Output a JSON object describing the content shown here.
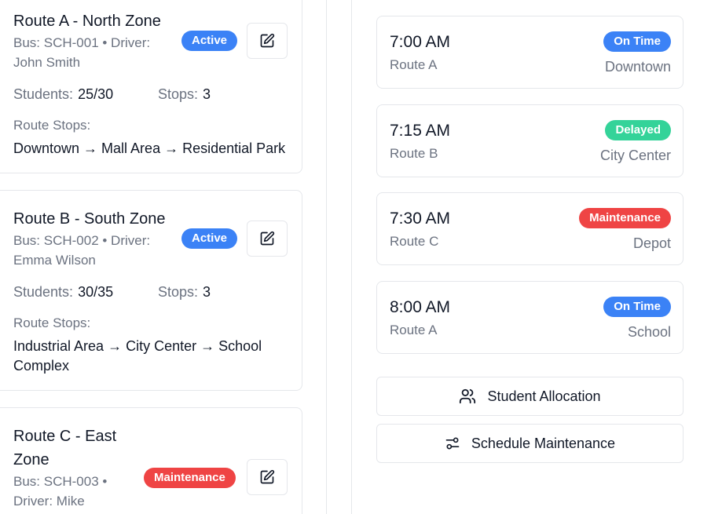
{
  "routes": [
    {
      "name": "Route A - North Zone",
      "bus_driver_line1": "Bus: SCH-001 • Driver:",
      "bus_driver_line2": "John Smith",
      "status": "Active",
      "students_label": "Students:",
      "students_value": "25/30",
      "stops_label": "Stops:",
      "stops_value": "3",
      "route_stops_label": "Route Stops:",
      "route_stops_line1": "Downtown → Mall Area → Residential Park",
      "route_stops_line2": ""
    },
    {
      "name": "Route B - South Zone",
      "bus_driver_line1": "Bus: SCH-002 • Driver:",
      "bus_driver_line2": "Emma Wilson",
      "status": "Active",
      "students_label": "Students:",
      "students_value": "30/35",
      "stops_label": "Stops:",
      "stops_value": "3",
      "route_stops_label": "Route Stops:",
      "route_stops_line1": "Industrial Area → City Center → School",
      "route_stops_line2": "Complex"
    },
    {
      "name_line1": "Route C - East",
      "name_line2": "Zone",
      "bus_driver_line1": "Bus: SCH-003 •",
      "bus_driver_line2": "Driver: Mike",
      "status": "Maintenance"
    }
  ],
  "schedule": [
    {
      "time": "7:00 AM",
      "route": "Route A",
      "status": "On Time",
      "location": "Downtown"
    },
    {
      "time": "7:15 AM",
      "route": "Route B",
      "status": "Delayed",
      "location": "City Center"
    },
    {
      "time": "7:30 AM",
      "route": "Route C",
      "status": "Maintenance",
      "location": "Depot"
    },
    {
      "time": "8:00 AM",
      "route": "Route A",
      "status": "On Time",
      "location": "School"
    }
  ],
  "actions": {
    "student_allocation": "Student Allocation",
    "schedule_maintenance": "Schedule Maintenance"
  },
  "colors": {
    "active": "#3b82f6",
    "on_time": "#3b82f6",
    "delayed": "#34d399",
    "maintenance": "#ef4444"
  }
}
